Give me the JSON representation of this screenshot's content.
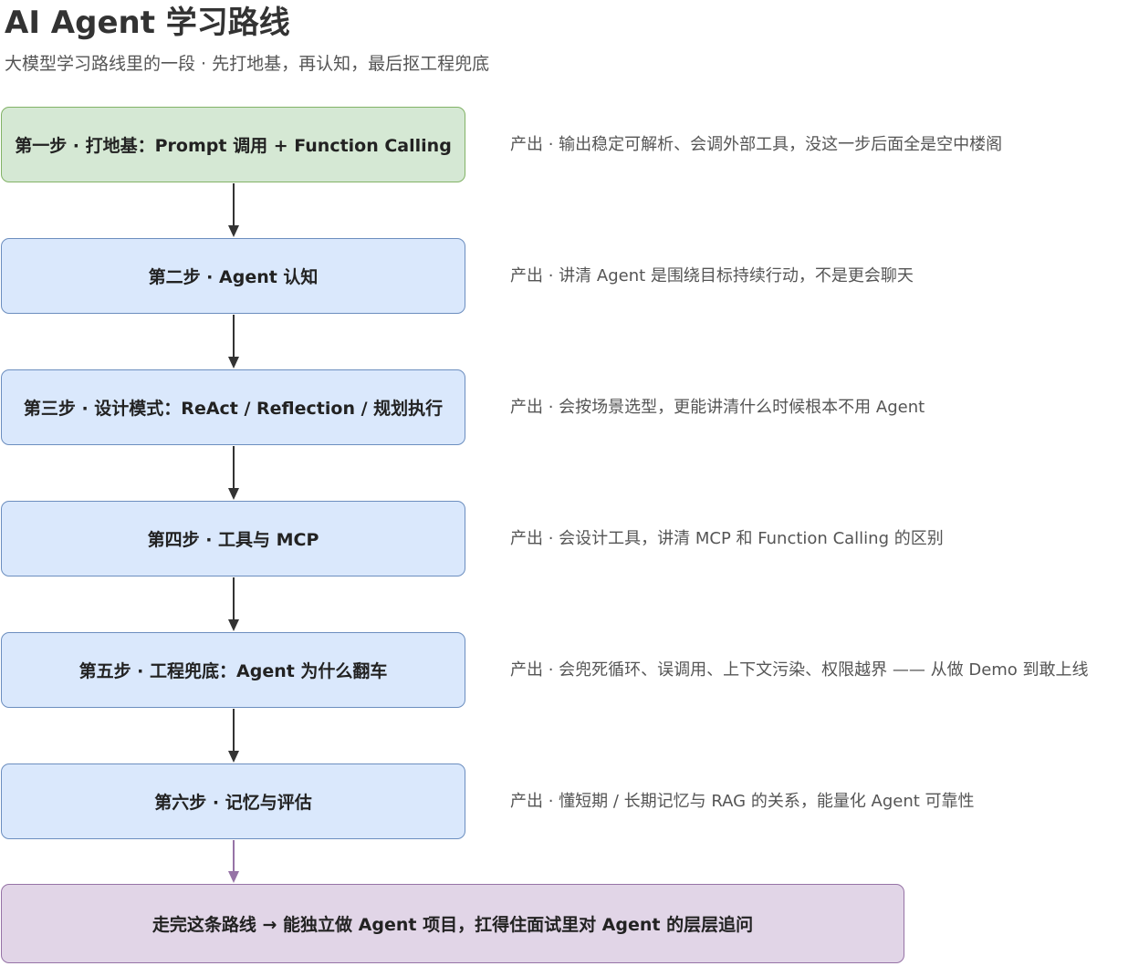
{
  "title": "AI Agent 学习路线",
  "subtitle": "大模型学习路线里的一段 · 先打地基，再认知，最后抠工程兜底",
  "steps": [
    {
      "label": "第一步 · 打地基：Prompt 调用 + Function Calling",
      "note": "产出 · 输出稳定可解析、会调外部工具，没这一步后面全是空中楼阁"
    },
    {
      "label": "第二步 · Agent 认知",
      "note": "产出 · 讲清 Agent 是围绕目标持续行动，不是更会聊天"
    },
    {
      "label": "第三步 · 设计模式：ReAct / Reflection / 规划执行",
      "note": "产出 · 会按场景选型，更能讲清什么时候根本不用 Agent"
    },
    {
      "label": "第四步 · 工具与 MCP",
      "note": "产出 · 会设计工具，讲清 MCP 和 Function Calling 的区别"
    },
    {
      "label": "第五步 · 工程兜底：Agent 为什么翻车",
      "note": "产出 · 会兜死循环、误调用、上下文污染、权限越界 —— 从做 Demo 到敢上线"
    },
    {
      "label": "第六步 · 记忆与评估",
      "note": "产出 · 懂短期 / 长期记忆与 RAG 的关系，能量化 Agent 可靠性"
    }
  ],
  "final": {
    "label": "走完这条路线 → 能独立做 Agent 项目，扛得住面试里对 Agent 的层层追问"
  },
  "colors": {
    "green_fill": "#d5e8d4",
    "green_stroke": "#82b366",
    "blue_fill": "#dae8fc",
    "blue_stroke": "#6c8ebf",
    "purple_fill": "#e1d5e7",
    "purple_stroke": "#9673a6",
    "arrow_dark": "#333333",
    "arrow_purple": "#9673a6"
  }
}
